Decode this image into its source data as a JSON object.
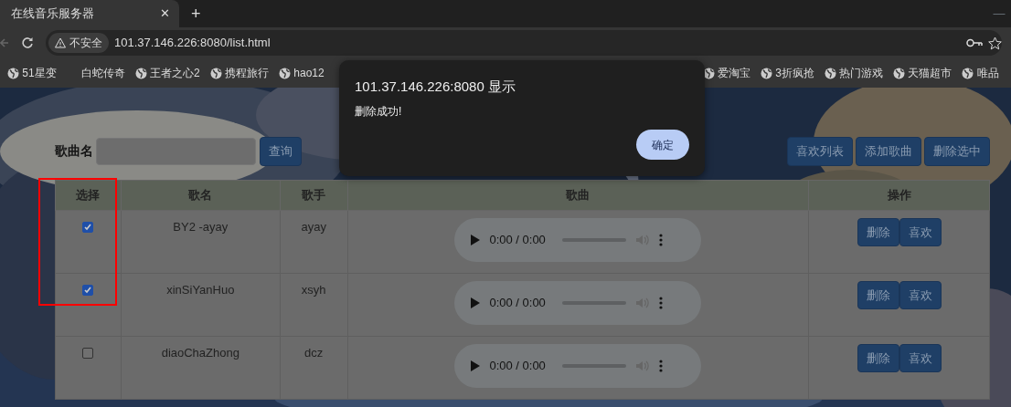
{
  "browser": {
    "tab": {
      "title": "在线音乐服务器",
      "close": "✕"
    },
    "new_tab": "+",
    "window_button": "—",
    "address": {
      "security": "不安全",
      "url": "101.37.146.226:8080/list.html"
    },
    "bookmarks": [
      {
        "label": "51星变",
        "icon": true
      },
      {
        "label": "白蛇传奇",
        "icon": false
      },
      {
        "label": "王者之心2",
        "icon": true
      },
      {
        "label": "携程旅行",
        "icon": true
      },
      {
        "label": "hao12",
        "icon": true
      },
      {
        "label": "爱淘宝",
        "icon": true
      },
      {
        "label": "3折疯抢",
        "icon": true
      },
      {
        "label": "热门游戏",
        "icon": true
      },
      {
        "label": "天猫超市",
        "icon": true
      },
      {
        "label": "唯品",
        "icon": true
      }
    ]
  },
  "page": {
    "search": {
      "label": "歌曲名",
      "button": "查询"
    },
    "actions": [
      "喜欢列表",
      "添加歌曲",
      "删除选中"
    ],
    "table": {
      "columns": [
        "选择",
        "歌名",
        "歌手",
        "歌曲",
        "操作"
      ],
      "rows": [
        {
          "checked": true,
          "title": "BY2 -ayay",
          "artist": "ayay",
          "time": "0:00 / 0:00",
          "actions": [
            "删除",
            "喜欢"
          ]
        },
        {
          "checked": true,
          "title": "xinSiYanHuo",
          "artist": "xsyh",
          "time": "0:00 / 0:00",
          "actions": [
            "删除",
            "喜欢"
          ]
        },
        {
          "checked": false,
          "title": "diaoChaZhong",
          "artist": "dcz",
          "time": "0:00 / 0:00",
          "actions": [
            "删除",
            "喜欢"
          ]
        }
      ]
    }
  },
  "dialog": {
    "title": "101.37.146.226:8080 显示",
    "message": "删除成功!",
    "button": "确定"
  },
  "annotation": {
    "kind": "highlight-box"
  }
}
